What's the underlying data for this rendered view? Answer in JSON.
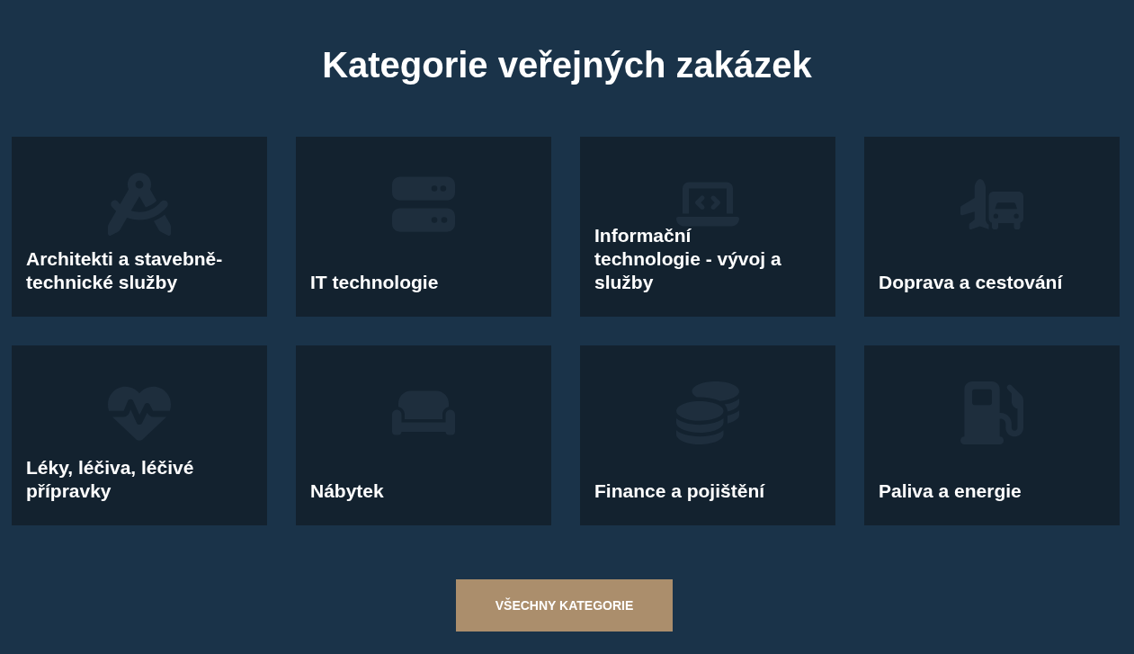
{
  "heading": "Kategorie veřejných zakázek",
  "categories": [
    {
      "title": "Architekti a stavebně-technické služby"
    },
    {
      "title": "IT technologie"
    },
    {
      "title": "Informační technologie - vývoj a služby"
    },
    {
      "title": "Doprava a cestování"
    },
    {
      "title": "Léky, léčiva, léčivé přípravky"
    },
    {
      "title": "Nábytek"
    },
    {
      "title": "Finance a pojištění"
    },
    {
      "title": "Paliva a energie"
    }
  ],
  "button": {
    "label": "VŠECHNY KATEGORIE"
  }
}
